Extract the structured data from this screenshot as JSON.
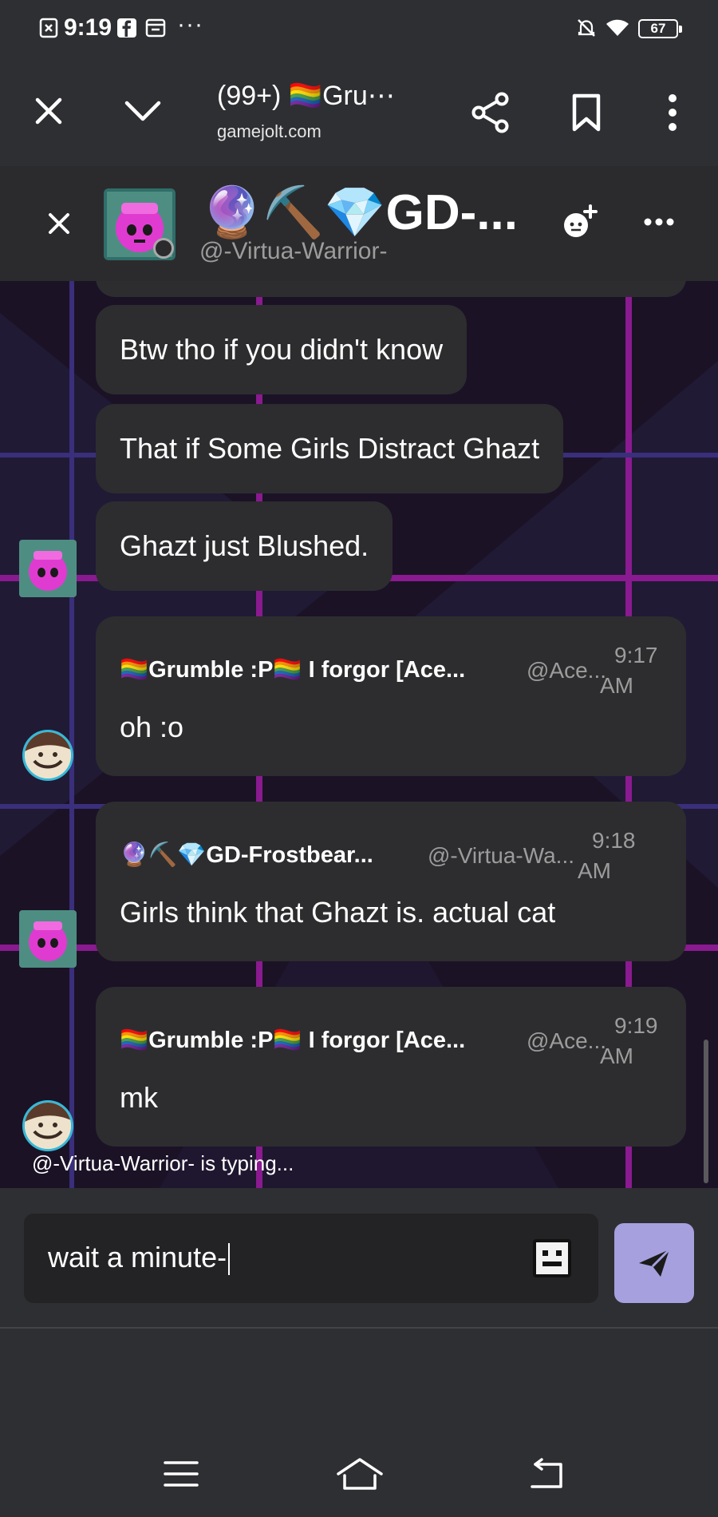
{
  "status_bar": {
    "time": "9:19",
    "battery": "67",
    "icons": [
      "notification-x-icon",
      "facebook-icon",
      "mail-icon",
      "more-dots-icon",
      "mute-bell-icon",
      "wifi-icon",
      "battery-icon"
    ]
  },
  "browser": {
    "title": "(99+) 🏳️‍🌈Gru⋯",
    "url": "gamejolt.com",
    "icons": [
      "close-icon",
      "chevron-down-icon",
      "share-icon",
      "bookmark-icon",
      "kebab-menu-icon"
    ]
  },
  "chat_header": {
    "title": "🔮⛏️💎GD-...",
    "subtitle": "@-Virtua-Warrior-",
    "icons": [
      "close-icon",
      "add-friend-icon",
      "more-options-icon"
    ]
  },
  "messages": {
    "m1": "Btw tho if you didn't know",
    "m2": "That if Some Girls Distract Ghazt",
    "m3": "Ghazt just Blushed.",
    "m4": {
      "author": "🏳️‍🌈Grumble :P🏳️‍🌈 I forgor [Ace...",
      "handle": "@Ace...",
      "time": "9:17 AM",
      "time_a": "9:17",
      "time_b": "AM",
      "text": "oh :o"
    },
    "m5": {
      "author": "🔮⛏️💎GD-Frostbear...",
      "handle": "@-Virtua-Wa...",
      "time": "9:18 AM",
      "time_a": "9:18",
      "time_b": "AM",
      "text": "Girls think that Ghazt is. actual cat"
    },
    "m6": {
      "author": "🏳️‍🌈Grumble :P🏳️‍🌈 I forgor [Ace...",
      "handle": "@Ace...",
      "time": "9:19 AM",
      "time_a": "9:19",
      "time_b": "AM",
      "text": "mk"
    }
  },
  "typing_indicator": "@-Virtua-Warrior- is typing...",
  "composer": {
    "value": "wait a minute-",
    "emoji_icon": "emoji-picker-icon",
    "send_icon": "send-icon"
  },
  "colors": {
    "background": "#2e2f32",
    "bubble": "#2d2d2f",
    "send_button": "#a6a0de",
    "chat_bg": "#1b1226",
    "grid_magenta": "#8a1a8f"
  },
  "nav_bar": {
    "icons": [
      "menu-icon",
      "home-icon",
      "back-icon"
    ]
  }
}
